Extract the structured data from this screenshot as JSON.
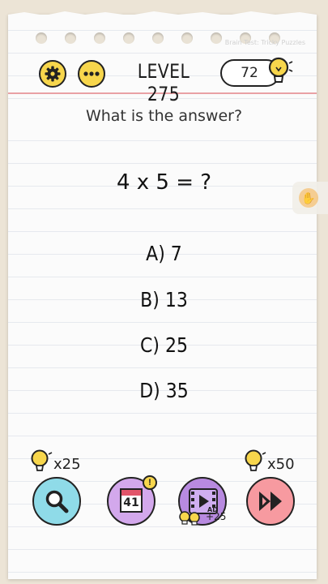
{
  "header": {
    "level_title": "LEVEL 275",
    "hint_count": "72",
    "watermark": "Brain Test: Tricky Puzzles"
  },
  "question": {
    "prompt": "What is the answer?",
    "equation": "4 x 5 = ?"
  },
  "answers": [
    {
      "label": "A)  7"
    },
    {
      "label": "B) 13"
    },
    {
      "label": "C) 25"
    },
    {
      "label": "D) 35"
    }
  ],
  "toolbar": {
    "hint_cost": "x25",
    "calendar_number": "41",
    "calendar_badge": "!",
    "video_ad_label": "AD",
    "video_reward": "+25",
    "skip_cost": "x50"
  },
  "colors": {
    "accent_yellow": "#f7d64c",
    "hint_button": "#8fdbe8",
    "calendar_button": "#d3a8ec",
    "video_button": "#b88ae0",
    "skip_button": "#f79aa0",
    "margin_line": "#e9a1a5"
  },
  "icons": [
    "gear-icon",
    "more-icon",
    "lightbulb-icon",
    "search-icon",
    "calendar-icon",
    "video-icon",
    "skip-icon"
  ]
}
